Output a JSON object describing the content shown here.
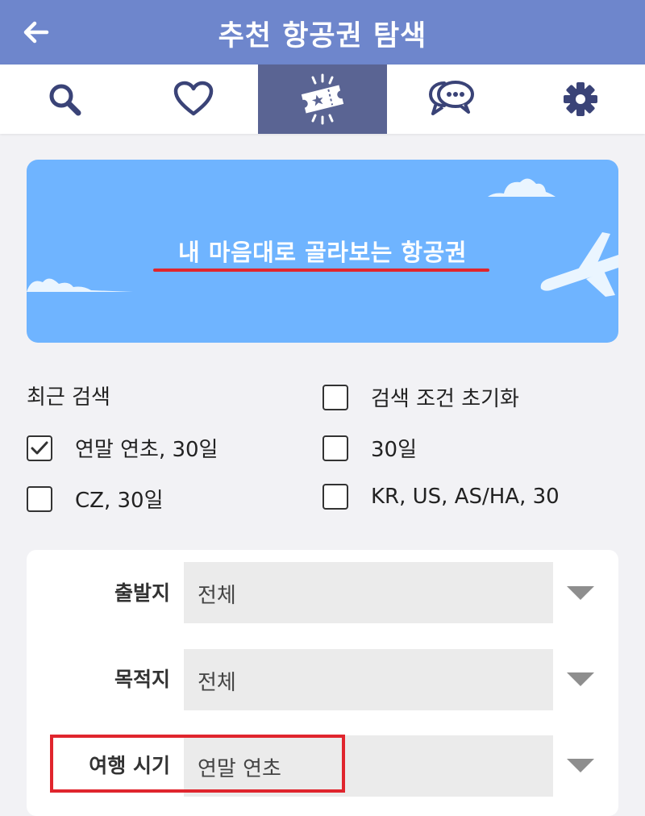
{
  "header": {
    "title": "추천 항공권 탐색"
  },
  "tabs": [
    {
      "icon": "search-icon"
    },
    {
      "icon": "heart-icon"
    },
    {
      "icon": "ticket-icon",
      "active": true
    },
    {
      "icon": "chat-icon"
    },
    {
      "icon": "gear-icon"
    }
  ],
  "banner": {
    "title": "내 마음대로 골라보는 항공권"
  },
  "recent": {
    "label": "최근 검색",
    "reset_label": "검색 조건 초기화",
    "items": [
      {
        "label": "연말 연초, 30일",
        "checked": true
      },
      {
        "label": "30일",
        "checked": false
      },
      {
        "label": "CZ, 30일",
        "checked": false
      },
      {
        "label": "KR, US, AS/HA, 30",
        "checked": false
      }
    ]
  },
  "form": {
    "departure": {
      "label": "출발지",
      "value": "전체"
    },
    "destination": {
      "label": "목적지",
      "value": "전체"
    },
    "travel_period": {
      "label": "여행 시기",
      "value": "연말 연초"
    }
  },
  "colors": {
    "header": "#6e86cc",
    "active_tab": "#5a6493",
    "banner": "#6fb4ff",
    "highlight": "#e0252d"
  }
}
